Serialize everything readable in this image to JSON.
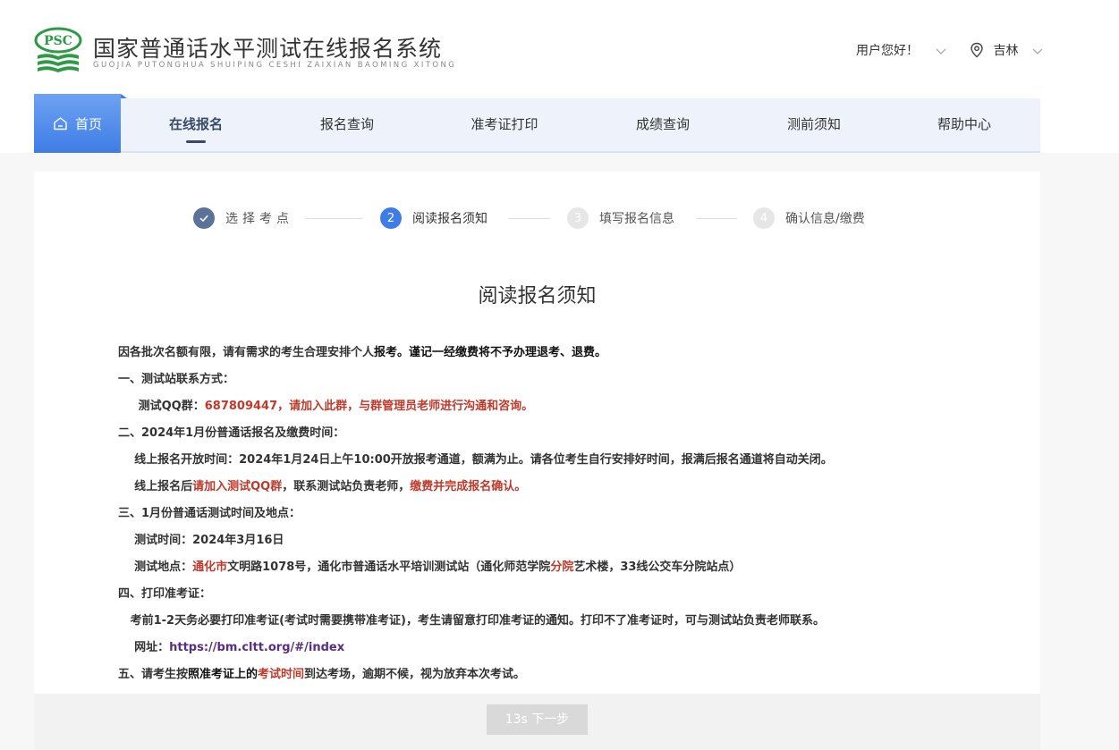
{
  "header": {
    "logo_mark_text": "PSC",
    "title": "国家普通话水平测试在线报名系统",
    "subtitle": "GUOJIA PUTONGHUA SHUIPING CESHI ZAIXIAN BAOMING XITONG",
    "user_greeting": "用户您好！",
    "location": "吉林"
  },
  "nav": {
    "home": "首页",
    "items": [
      "在线报名",
      "报名查询",
      "准考证打印",
      "成绩查询",
      "测前须知",
      "帮助中心"
    ],
    "active_index": 0
  },
  "steps": [
    {
      "number": "",
      "label": "选择考点",
      "state": "done"
    },
    {
      "number": "2",
      "label": "阅读报名须知",
      "state": "current"
    },
    {
      "number": "3",
      "label": "填写报名信息",
      "state": "todo"
    },
    {
      "number": "4",
      "label": "确认信息/缴费",
      "state": "todo"
    }
  ],
  "notice": {
    "title": "阅读报名须知",
    "lines": [
      [
        {
          "t": "因各批次名额有限，请有需求的考生合理安排个人",
          "c": ""
        },
        {
          "t": "报考。谨记一经缴费将不予办理退考、退费。",
          "c": "black"
        }
      ],
      [
        {
          "t": "一、测试站联系方式：",
          "c": ""
        }
      ],
      [
        {
          "t": "     测试QQ群：",
          "c": ""
        },
        {
          "t": "687809447，请加入此群，与群管理员老师进行沟通和咨询。",
          "c": "red"
        }
      ],
      [
        {
          "t": "二、2024年1月份普通话报名及缴费时间：",
          "c": ""
        }
      ],
      [
        {
          "t": "    线上报名开放时间：2024年1月24日上午10:00开放报考通道，额满为止。请各位考生自行安排好时间，报满后报名通道将自动关闭。",
          "c": ""
        }
      ],
      [
        {
          "t": "    线上报名后",
          "c": ""
        },
        {
          "t": "请加入测试QQ群",
          "c": "red"
        },
        {
          "t": "，联系测试站负责老师，",
          "c": ""
        },
        {
          "t": "缴费并完成报名确认。",
          "c": "red"
        }
      ],
      [
        {
          "t": "三、1月份普通话测试时间及地点：",
          "c": ""
        }
      ],
      [
        {
          "t": "    测试时间：2024年3月16日",
          "c": ""
        }
      ],
      [
        {
          "t": "    测试地点：",
          "c": ""
        },
        {
          "t": "通化市",
          "c": "red"
        },
        {
          "t": "文明路1078号，通化市普通话水平培训测试站（通化师范学院",
          "c": ""
        },
        {
          "t": "分院",
          "c": "red"
        },
        {
          "t": "艺术楼，33线公交车分院站点）",
          "c": ""
        }
      ],
      [
        {
          "t": "四、打印准考证：",
          "c": ""
        }
      ],
      [
        {
          "t": "   考前1-2天务必要打印准考证(考试时需要携带准考证)，考生请留意打印准考证的通知。打印不了准考证时，可与测试站负责老师联系。",
          "c": ""
        }
      ],
      [
        {
          "t": "    网址：",
          "c": ""
        },
        {
          "t": "https://bm.cltt.org/#/index",
          "c": "purple"
        }
      ],
      [
        {
          "t": "五、请考生按",
          "c": ""
        },
        {
          "t": "照准考证上的",
          "c": "black"
        },
        {
          "t": "考试时间",
          "c": "red"
        },
        {
          "t": "到达考场，逾期不候，视为放弃本次考试。",
          "c": ""
        }
      ]
    ]
  },
  "footer": {
    "next_button": "13s 下一步"
  },
  "colors": {
    "accent": "#3e7de6",
    "done_step": "#5b7398",
    "notice_red": "#c0392b",
    "logo_green": "#2e9a45"
  }
}
